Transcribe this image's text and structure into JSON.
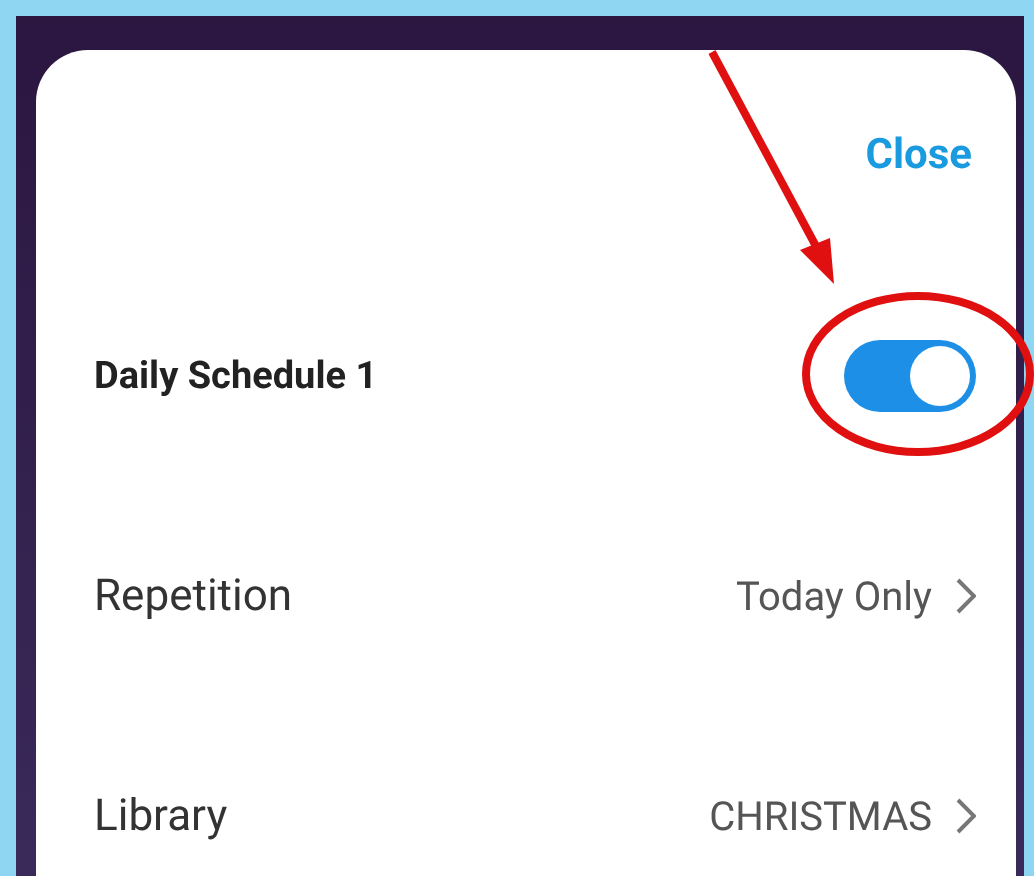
{
  "close": "Close",
  "schedule": {
    "name": "Daily Schedule 1",
    "on": true
  },
  "rows": [
    {
      "label": "Repetition",
      "value": "Today Only"
    },
    {
      "label": "Library",
      "value": "CHRISTMAS"
    }
  ]
}
